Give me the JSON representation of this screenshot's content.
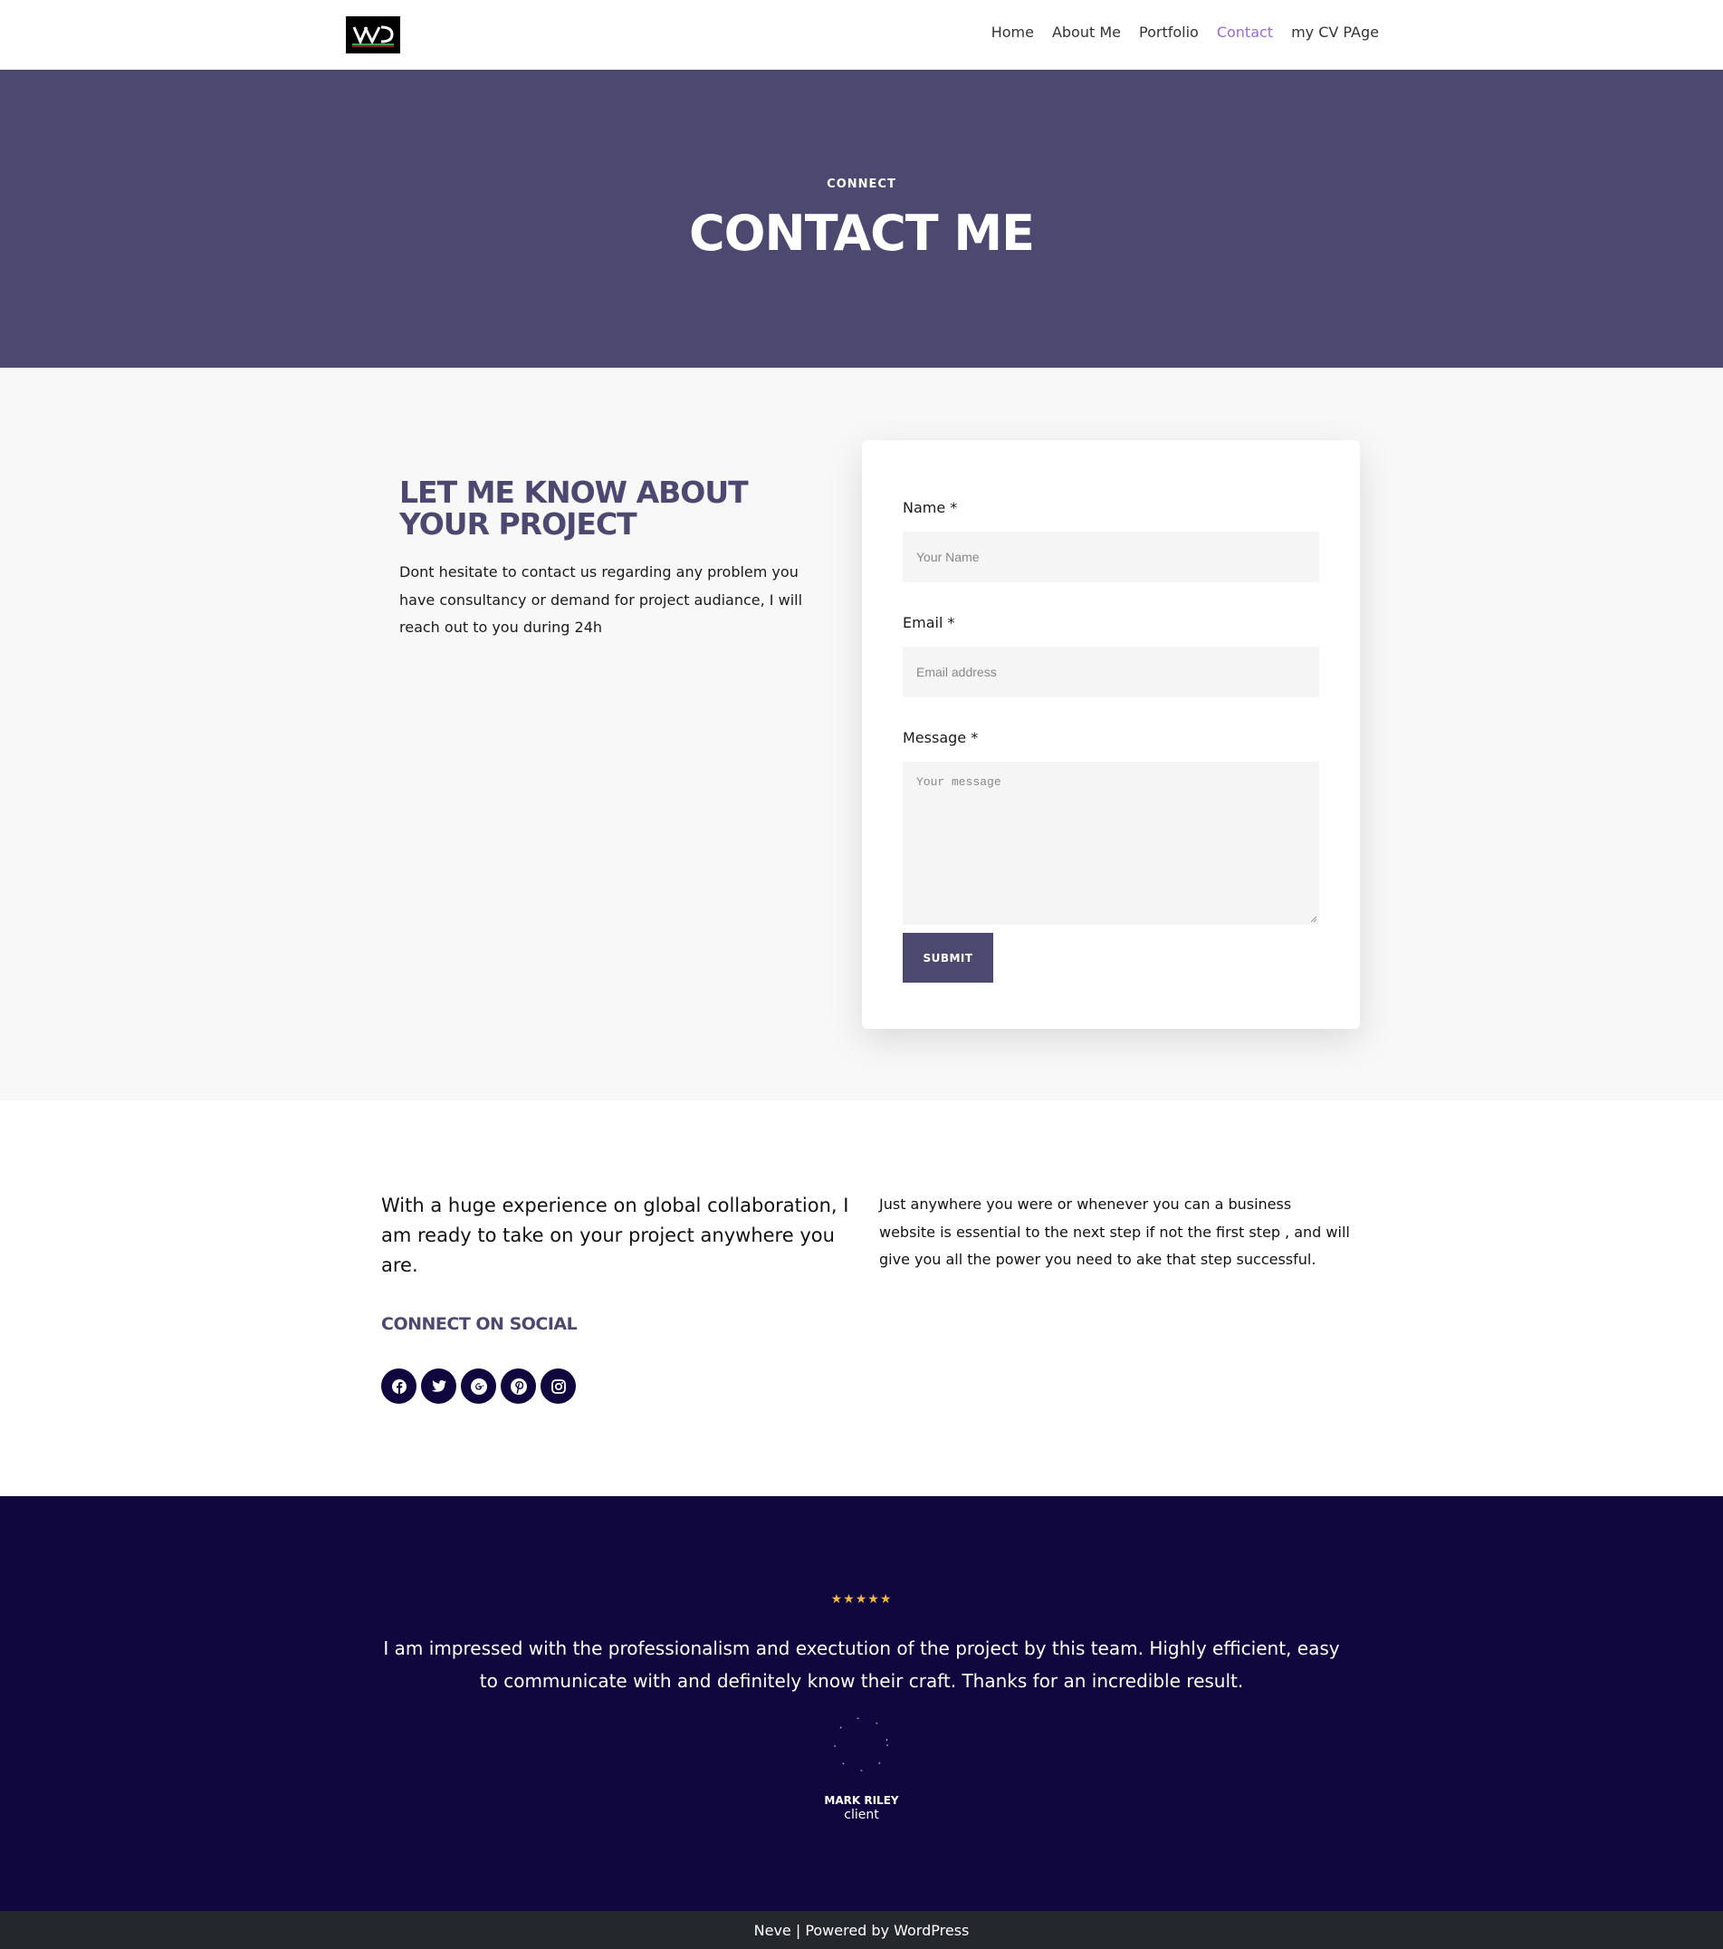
{
  "header": {
    "logo_text": "LVD",
    "nav": [
      {
        "label": "Home"
      },
      {
        "label": "About Me"
      },
      {
        "label": "Portfolio"
      },
      {
        "label": "Contact",
        "active": true
      },
      {
        "label": "my CV PAge"
      }
    ]
  },
  "hero": {
    "kicker": "CONNECT",
    "title": "CONTACT ME",
    "background": "#4d4870"
  },
  "contact": {
    "title": "LET ME KNOW ABOUT YOUR PROJECT",
    "text": "Dont hesitate to contact us regarding any problem you have consultancy or demand for project audiance, I will reach out to you during 24h",
    "form": {
      "name_label": "Name *",
      "name_placeholder": "Your Name",
      "email_label": "Email *",
      "email_placeholder": "Email address",
      "message_label": "Message *",
      "message_placeholder": "Your message",
      "submit_label": "SUBMIT"
    }
  },
  "collab": {
    "lead": "With a huge experience on global collaboration, I am ready to take on your project anywhere you are.",
    "side": "Just anywhere you were or whenever you can a business website is essential to the next step if not the first step , and will give you all the power you need to ake that step successful.",
    "social_title": "CONNECT ON SOCIAL",
    "social_icons": [
      "facebook-icon",
      "twitter-icon",
      "google-plus-icon",
      "pinterest-icon",
      "instagram-icon"
    ]
  },
  "testimonial": {
    "rating": 5,
    "stars": "★★★★★",
    "quote": "I am impressed with the professionalism and exectution of the project by this team. Highly efficient, easy to communicate with and definitely know their craft. Thanks for an incredible result.",
    "name": "MARK RILEY",
    "role": "client",
    "background": "#0f073d",
    "star_color": "#f0b64c"
  },
  "footer": {
    "brand": "Neve",
    "separator": " | ",
    "powered": "Powered by WordPress"
  },
  "colors": {
    "accent": "#4d4870",
    "nav_active": "#9b6ad6",
    "dark_navy": "#0f073d",
    "footer_bg": "#24272c"
  }
}
